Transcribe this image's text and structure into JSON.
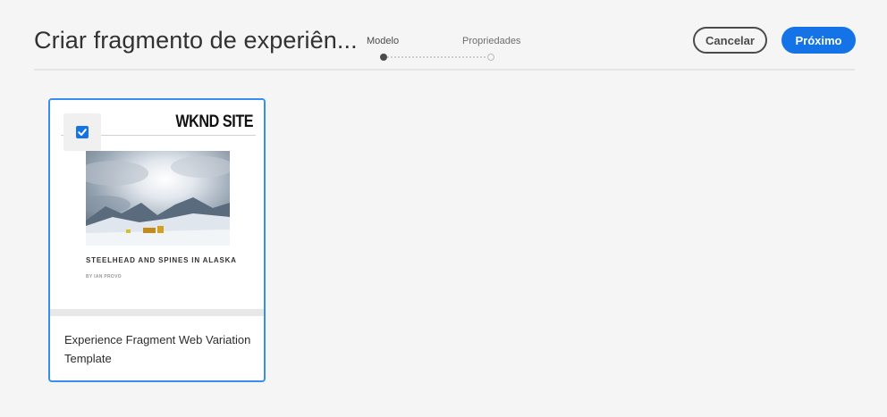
{
  "header": {
    "title": "Criar fragmento de experiên...",
    "cancel_label": "Cancelar",
    "next_label": "Próximo"
  },
  "stepper": {
    "steps": [
      {
        "label": "Modelo",
        "active": true
      },
      {
        "label": "Propriedades",
        "active": false
      }
    ]
  },
  "templates": [
    {
      "title": "Experience Fragment Web Variation Template",
      "selected": true,
      "preview": {
        "site_name": "WKND SITE",
        "article_title": "STEELHEAD AND SPINES IN ALASKA",
        "byline": "BY IAN PROVO"
      }
    }
  ],
  "colors": {
    "accent": "#1473e6",
    "selection_border": "#378ef0",
    "background": "#f5f5f5"
  }
}
